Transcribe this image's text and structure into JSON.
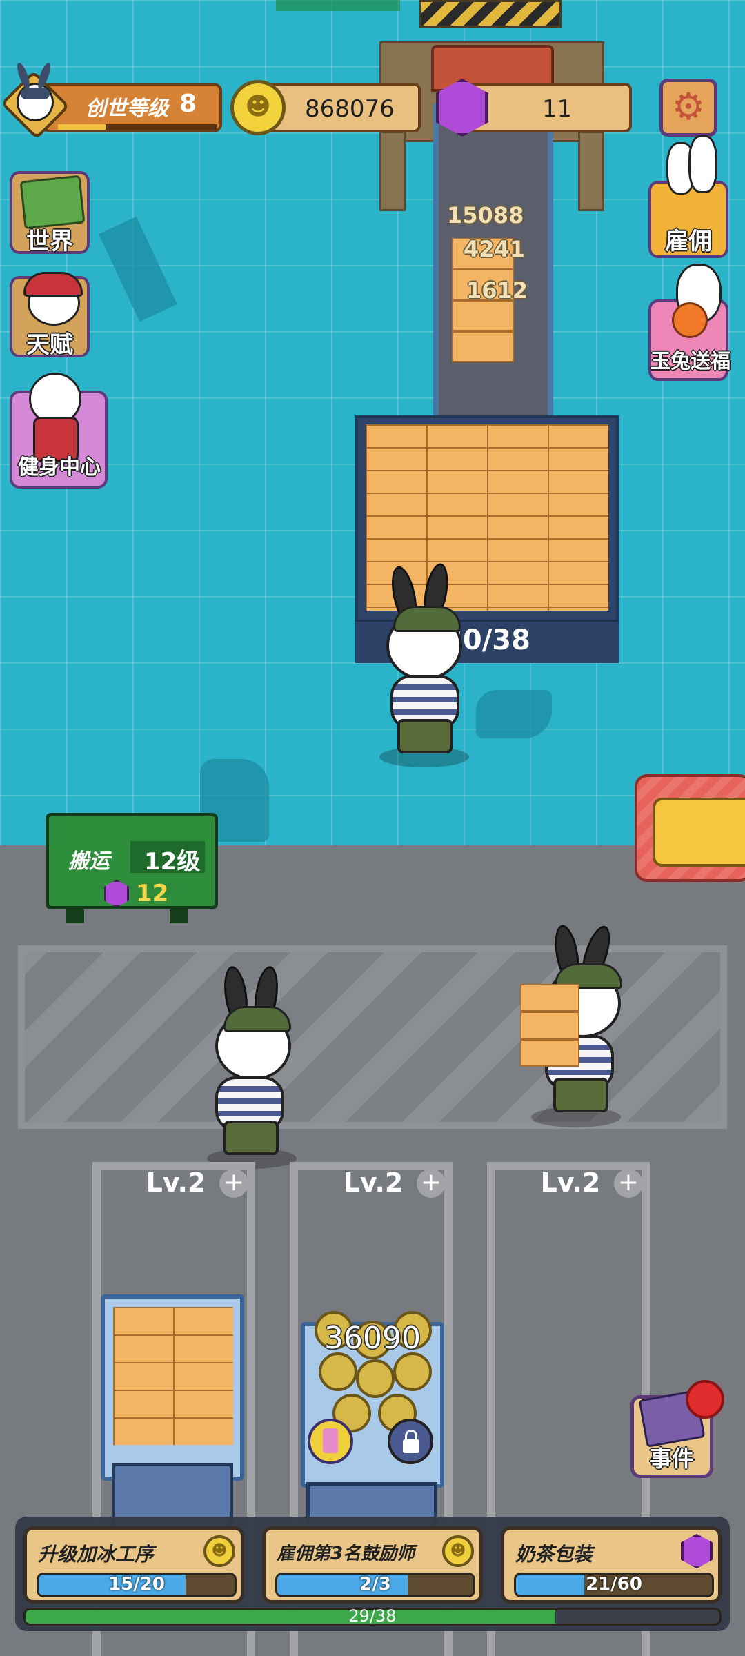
{
  "header": {
    "level_label": "创世等级",
    "level_value": "8",
    "coins": "868076",
    "gems": "11",
    "level_progress": 0.3
  },
  "sidebar_left": [
    {
      "label": "世界",
      "icon": "world-map-icon"
    },
    {
      "label": "天赋",
      "icon": "talent-icon"
    },
    {
      "label": "健身中心",
      "icon": "gym-icon"
    }
  ],
  "sidebar_right": [
    {
      "label": "雇佣",
      "icon": "hire-icon"
    },
    {
      "label": "玉兔送福",
      "icon": "jade-rabbit-icon"
    }
  ],
  "events_button": {
    "label": "事件",
    "icon": "event-book-icon"
  },
  "floating_numbers": [
    "15088",
    "4241",
    "1612"
  ],
  "bin": {
    "count": "30/38"
  },
  "carry_upgrade": {
    "label": "搬运",
    "level": "12级",
    "cost": "12"
  },
  "slots": [
    {
      "level": "Lv.2"
    },
    {
      "level": "Lv.2",
      "coin_value": "36090"
    },
    {
      "level": "Lv.2"
    }
  ],
  "tasks": [
    {
      "title": "升级加冰工序",
      "progress": "15/20",
      "fraction": 0.75,
      "reward_icon": "coin-icon"
    },
    {
      "title": "雇佣第3名鼓励师",
      "progress": "2/3",
      "fraction": 0.667,
      "reward_icon": "coin-icon"
    },
    {
      "title": "奶茶包装",
      "progress": "21/60",
      "fraction": 0.35,
      "reward_icon": "gem-icon"
    }
  ],
  "overall_progress": {
    "text": "29/38",
    "fraction": 0.763
  },
  "colors": {
    "floor": "#2ab3c9",
    "accent_orange": "#d58235",
    "task_bar": "#4aa9e6",
    "gem": "#b04ad8"
  }
}
